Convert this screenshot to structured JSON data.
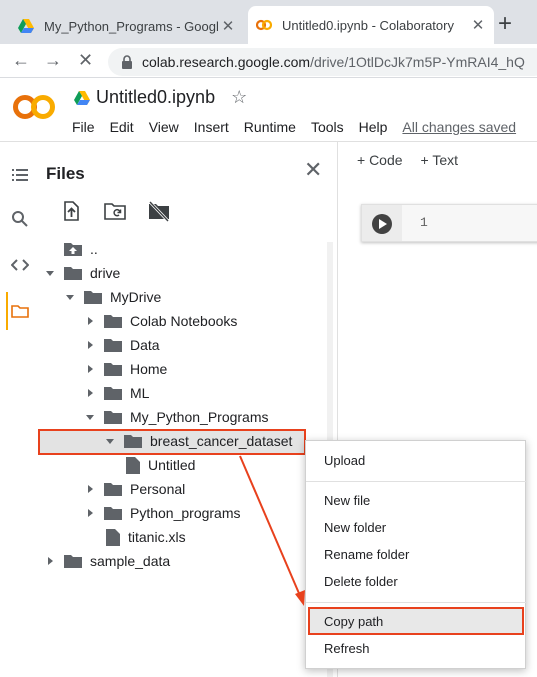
{
  "browser": {
    "tabs": [
      {
        "title": "My_Python_Programs - Google",
        "active": false
      },
      {
        "title": "Untitled0.ipynb - Colaboratory",
        "active": true
      }
    ],
    "new_tab_label": "+",
    "url_main": "colab.research.google.com",
    "url_rest": "/drive/1OtlDcJk7m5P-YmRAI4_hQ"
  },
  "colab": {
    "logo_text": "CO",
    "notebook_title": "Untitled0.ipynb",
    "menu": [
      "File",
      "Edit",
      "View",
      "Insert",
      "Runtime",
      "Tools",
      "Help"
    ],
    "save_status": "All changes saved"
  },
  "files_panel": {
    "title": "Files",
    "tree": [
      {
        "label": "..",
        "indent": 0,
        "kind": "up"
      },
      {
        "label": "drive",
        "indent": 0,
        "kind": "folder",
        "caret": "down"
      },
      {
        "label": "MyDrive",
        "indent": 1,
        "kind": "folder",
        "caret": "down"
      },
      {
        "label": "Colab Notebooks",
        "indent": 2,
        "kind": "folder",
        "caret": "right"
      },
      {
        "label": "Data",
        "indent": 2,
        "kind": "folder",
        "caret": "right"
      },
      {
        "label": "Home",
        "indent": 2,
        "kind": "folder",
        "caret": "right"
      },
      {
        "label": "ML",
        "indent": 2,
        "kind": "folder",
        "caret": "right"
      },
      {
        "label": "My_Python_Programs",
        "indent": 2,
        "kind": "folder",
        "caret": "down"
      },
      {
        "label": "breast_cancer_dataset",
        "indent": 3,
        "kind": "folder",
        "caret": "down",
        "selected": true
      },
      {
        "label": "Untitled",
        "indent": 3,
        "kind": "file"
      },
      {
        "label": "Personal",
        "indent": 2,
        "kind": "folder",
        "caret": "right"
      },
      {
        "label": "Python_programs",
        "indent": 2,
        "kind": "folder",
        "caret": "right"
      },
      {
        "label": "titanic.xls",
        "indent": 2,
        "kind": "file"
      },
      {
        "label": "sample_data",
        "indent": 0,
        "kind": "folder",
        "caret": "right"
      }
    ]
  },
  "notebook": {
    "add_code": "+ Code",
    "add_text": "+ Text",
    "cell_line_number": "1"
  },
  "context_menu": {
    "items": [
      "Upload",
      "New file",
      "New folder",
      "Rename folder",
      "Delete folder",
      "Copy path",
      "Refresh"
    ],
    "highlighted": "Copy path"
  },
  "colors": {
    "annotation_red": "#e8411d",
    "colab_orange": "#f9ab00"
  }
}
